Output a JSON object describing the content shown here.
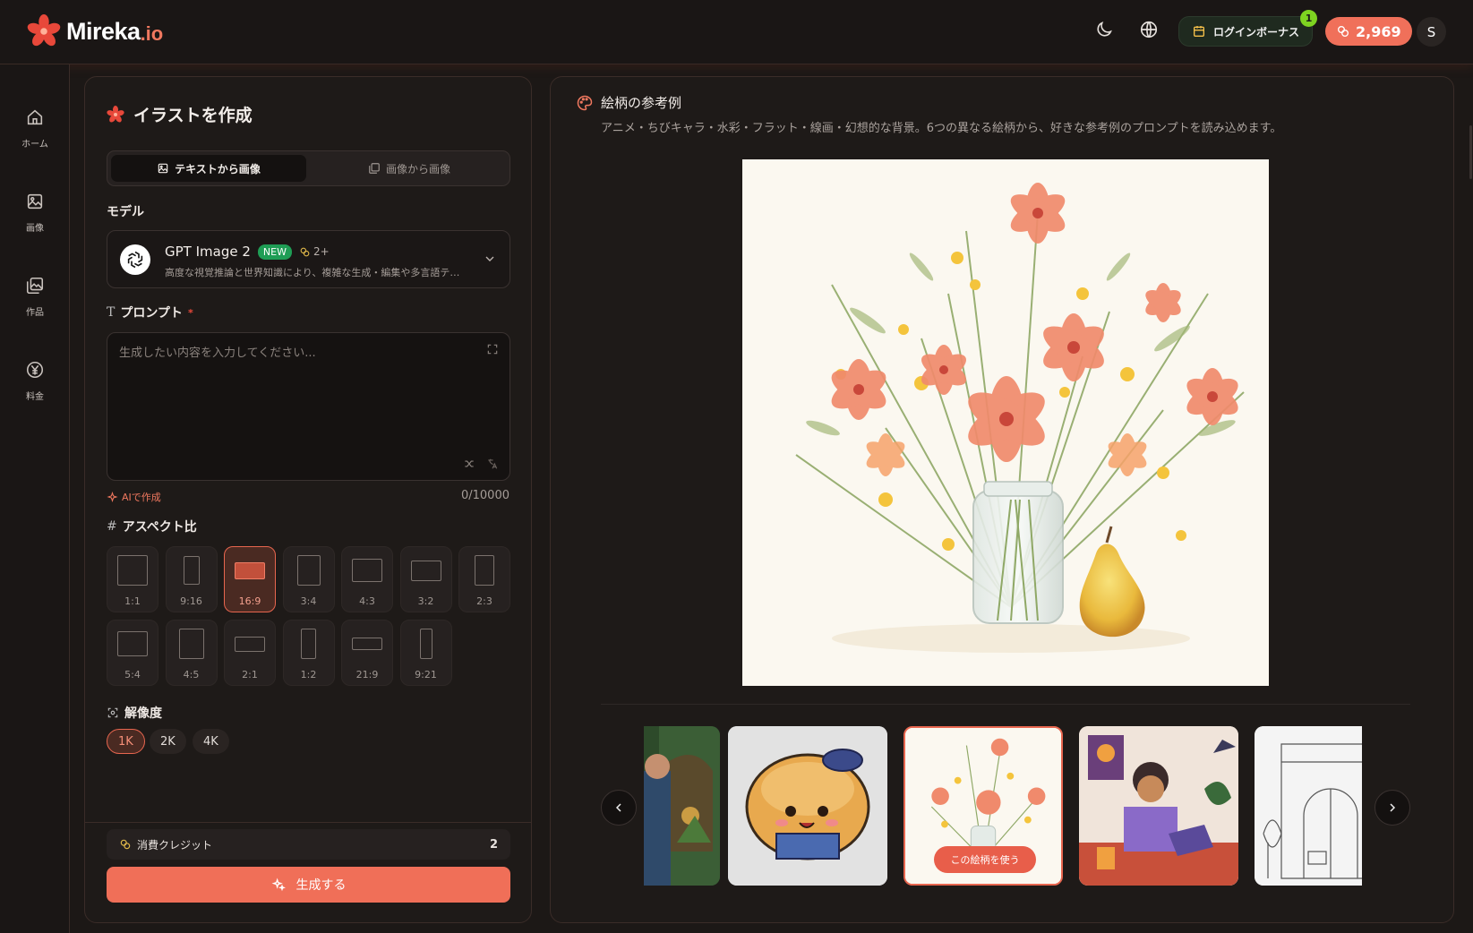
{
  "header": {
    "brand_name": "Mireka",
    "brand_tld": ".io",
    "login_bonus_label": "ログインボーナス",
    "login_bonus_count": "1",
    "credits": "2,969",
    "avatar_initial": "S"
  },
  "sidebar": {
    "items": [
      {
        "label": "ホーム",
        "icon": "home-icon"
      },
      {
        "label": "画像",
        "icon": "image-icon"
      },
      {
        "label": "作品",
        "icon": "gallery-icon"
      },
      {
        "label": "料金",
        "icon": "yen-icon"
      }
    ]
  },
  "create": {
    "title": "イラストを作成",
    "tabs": [
      {
        "label": "テキストから画像",
        "active": true
      },
      {
        "label": "画像から画像",
        "active": false
      }
    ],
    "model_label": "モデル",
    "model": {
      "name": "GPT Image 2",
      "badge": "NEW",
      "cost": "2+",
      "description": "高度な視覚推論と世界知識により、複雑な生成・編集や多言語テキストにも対応"
    },
    "prompt_label": "プロンプト",
    "prompt_required": "*",
    "prompt_placeholder": "生成したい内容を入力してください...",
    "ai_create_label": "AIで作成",
    "char_counter": "0/10000",
    "aspect_label": "アスペクト比",
    "aspect_ratios": [
      {
        "label": "1:1",
        "active": false
      },
      {
        "label": "9:16",
        "active": false
      },
      {
        "label": "16:9",
        "active": true
      },
      {
        "label": "3:4",
        "active": false
      },
      {
        "label": "4:3",
        "active": false
      },
      {
        "label": "3:2",
        "active": false
      },
      {
        "label": "2:3",
        "active": false
      },
      {
        "label": "5:4",
        "active": false
      },
      {
        "label": "4:5",
        "active": false
      },
      {
        "label": "2:1",
        "active": false
      },
      {
        "label": "1:2",
        "active": false
      },
      {
        "label": "21:9",
        "active": false
      },
      {
        "label": "9:21",
        "active": false
      }
    ],
    "resolution_label": "解像度",
    "resolutions": [
      {
        "label": "1K",
        "active": true
      },
      {
        "label": "2K",
        "active": false
      },
      {
        "label": "4K",
        "active": false
      }
    ],
    "cost_label": "消費クレジット",
    "cost_value": "2",
    "generate_label": "生成する"
  },
  "examples": {
    "title": "絵柄の参考例",
    "subtitle": "アニメ・ちびキャラ・水彩・フラット・線画・幻想的な背景。6つの異なる絵柄から、好きな参考例のプロンプトを読み込めます。",
    "use_style_label": "この絵柄を使う",
    "selected_index": 2
  },
  "colors": {
    "accent": "#f06f58",
    "background": "#1c1816",
    "panel": "#1e1a18",
    "new_badge": "#1f9d55",
    "bonus_badge": "#7ed321"
  }
}
